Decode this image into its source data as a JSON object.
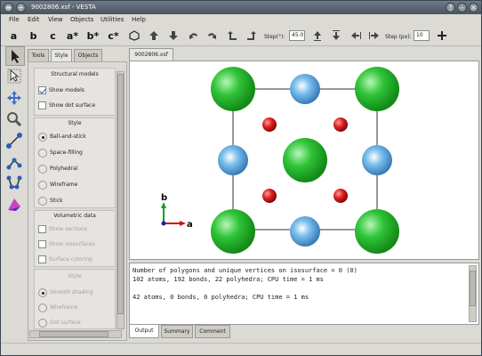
{
  "window": {
    "title": "9002806.xsf - VESTA"
  },
  "menus": [
    "File",
    "Edit",
    "View",
    "Objects",
    "Utilities",
    "Help"
  ],
  "toolbar": {
    "letters": [
      "a",
      "b",
      "c",
      "a*",
      "b*",
      "c*"
    ],
    "step_deg_label": "Step(°):",
    "step_deg": "45.0",
    "step_px_label": "Step (px):",
    "step_px": "10"
  },
  "panel_tabs": [
    "Tools",
    "Style",
    "Objects"
  ],
  "structural": {
    "title": "Structural models",
    "show_models": "Show models",
    "show_dot": "Show dot surface"
  },
  "style": {
    "title": "Style",
    "options": [
      "Ball-and-stick",
      "Space-filling",
      "Polyhedral",
      "Wireframe",
      "Stick"
    ]
  },
  "volumetric": {
    "title": "Volumetric data",
    "options": [
      "Show sections",
      "Show isosurfaces",
      "Surface coloring"
    ]
  },
  "vstyle": {
    "title": "Style",
    "options": [
      "Smooth shading",
      "Wireframe",
      "Dot surface"
    ]
  },
  "file_tab": "9002806.xsf",
  "axes": {
    "b": "b",
    "a": "a"
  },
  "output": {
    "lines": [
      "Number of polygons and unique vertices on isosurface = 0 (0)",
      "102 atoms, 192 bonds, 22 polyhedra; CPU time = 1 ms",
      "",
      "42 atoms, 0 bonds, 0 polyhedra; CPU time = 1 ms"
    ]
  },
  "output_tabs": [
    "Output",
    "Summary",
    "Comment"
  ],
  "colors": {
    "green_atom": "#22b52a",
    "blue_atom": "#5aa8e0",
    "red_atom": "#d81818"
  }
}
